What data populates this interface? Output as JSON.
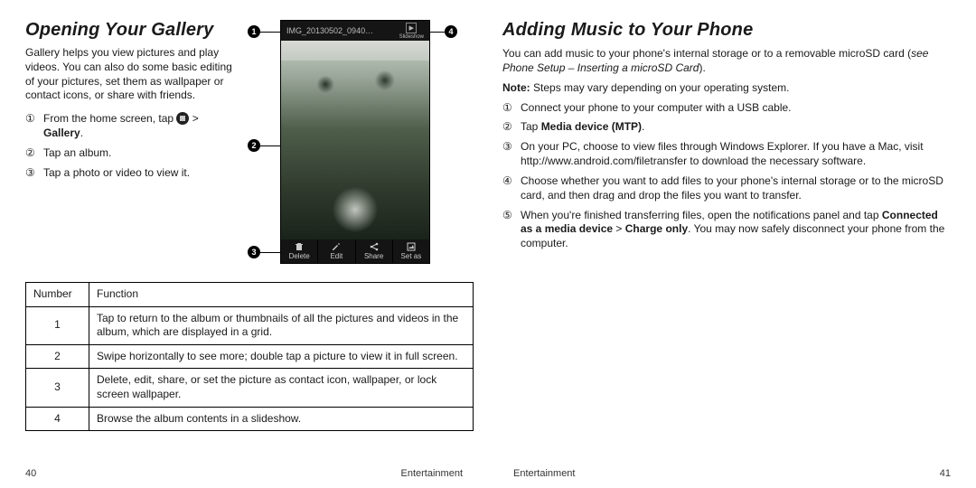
{
  "left": {
    "heading": "Opening Your Gallery",
    "intro": "Gallery helps you view pictures and play videos. You can also do some basic editing of your pictures, set them as wallpaper or contact icons, or share with friends.",
    "steps": [
      {
        "num": "①",
        "pre": "From the home screen, tap ",
        "post_before_bold": " > ",
        "bold": "Gallery",
        "post": "."
      },
      {
        "num": "②",
        "text": "Tap an album."
      },
      {
        "num": "③",
        "text": "Tap a photo or video to view it."
      }
    ],
    "screenshot": {
      "title": "IMG_20130502_0940…",
      "slide_label": "Slideshow",
      "actions": [
        "Delete",
        "Edit",
        "Share",
        "Set as"
      ]
    },
    "callouts": {
      "c1": "1",
      "c2": "2",
      "c3": "3",
      "c4": "4"
    },
    "table": {
      "head": [
        "Number",
        "Function"
      ],
      "rows": [
        [
          "1",
          "Tap to return to the album or thumbnails of all the pictures and videos in the album, which are displayed in a grid."
        ],
        [
          "2",
          "Swipe horizontally to see more; double tap a picture to view it in full screen."
        ],
        [
          "3",
          "Delete, edit, share, or set the picture as contact icon, wallpaper, or lock screen wallpaper."
        ],
        [
          "4",
          "Browse the album contents in a slideshow."
        ]
      ]
    },
    "footer_pageno": "40",
    "footer_section": "Entertainment"
  },
  "right": {
    "heading": "Adding Music to Your Phone",
    "intro_pre": "You can add music to your phone's internal storage or to a removable microSD card (",
    "intro_ital": "see Phone Setup – Inserting a microSD Card",
    "intro_post": ").",
    "note_label": "Note:",
    "note_text": " Steps may vary depending on your operating system.",
    "steps": [
      {
        "num": "①",
        "text": "Connect your phone to your computer with a USB cable."
      },
      {
        "num": "②",
        "pre": "Tap ",
        "bold": "Media device (MTP)",
        "post": "."
      },
      {
        "num": "③",
        "text": "On your PC, choose to view files through Windows Explorer. If you have a Mac, visit http://www.android.com/filetransfer to download the necessary software."
      },
      {
        "num": "④",
        "text": "Choose whether you want to add files to your phone's internal storage or to the microSD card, and then drag and drop the files you want to transfer."
      },
      {
        "num": "⑤",
        "pre": "When you're finished transferring files, open the notifications panel and tap ",
        "bold": "Connected as a media device",
        "mid": " > ",
        "bold2": "Charge only",
        "post": ". You may now safely disconnect your phone from the computer."
      }
    ],
    "footer_pageno": "41",
    "footer_section": "Entertainment"
  }
}
